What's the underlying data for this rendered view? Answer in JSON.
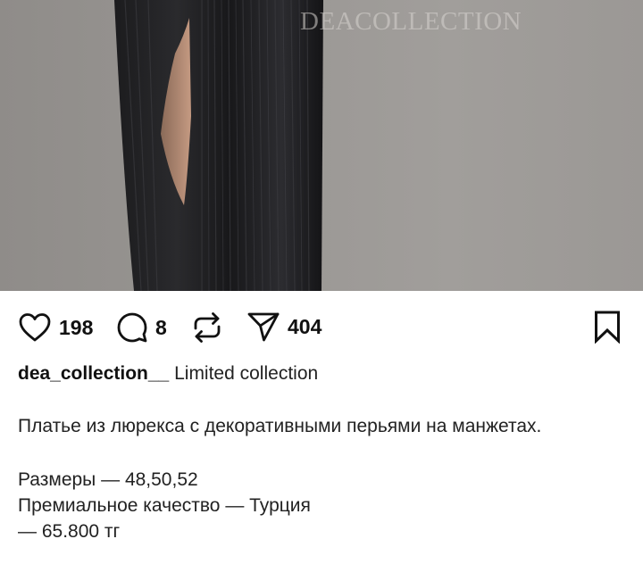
{
  "post": {
    "watermark": "DEACOLLECTION",
    "likes": "198",
    "comments": "8",
    "shares": "404",
    "username": "dea_collection__",
    "caption_title": "Limited collection",
    "description": "Платье из люрекса с декоративными перьями на манжетах.",
    "sizes_line": "Размеры — 48,50,52",
    "quality_line": "Премиальное качество — Турция",
    "price_line": "— 65.800 тг"
  },
  "icons": {
    "like": "heart-icon",
    "comment": "comment-icon",
    "repost": "repost-icon",
    "share": "share-icon",
    "save": "bookmark-icon"
  },
  "colors": {
    "text": "#111111",
    "background": "#ffffff"
  }
}
